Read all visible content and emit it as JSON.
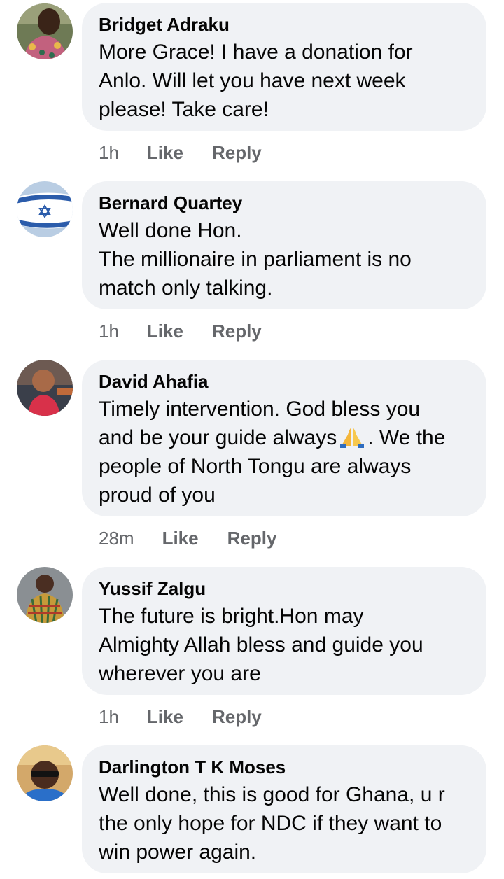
{
  "comments": [
    {
      "author": "Bridget Adraku",
      "lines": [
        "More Grace! I have a donation for",
        "Anlo. Will let you have next week",
        "please! Take care!"
      ],
      "time": "1h",
      "like_label": "Like",
      "reply_label": "Reply",
      "avatar_icon": "avatar-photo-woman"
    },
    {
      "author": "Bernard Quartey",
      "lines": [
        "Well done Hon.",
        "The millionaire in parliament is no",
        "match only talking."
      ],
      "time": "1h",
      "like_label": "Like",
      "reply_label": "Reply",
      "avatar_icon": "avatar-israel-flag"
    },
    {
      "author": "David Ahafia",
      "lines_before_emoji": "and be your guide always",
      "line1": "Timely intervention. God bless you",
      "line2_after_emoji": ". We the",
      "line3": "people of North Tongu are always",
      "line4": "proud of you",
      "emoji": "praying-hands-icon",
      "time": "28m",
      "like_label": "Like",
      "reply_label": "Reply",
      "avatar_icon": "avatar-photo-baby"
    },
    {
      "author": "Yussif Zalgu",
      "lines": [
        "The future is bright.Hon may",
        "Almighty Allah bless and guide you",
        "wherever you are"
      ],
      "time": "1h",
      "like_label": "Like",
      "reply_label": "Reply",
      "avatar_icon": "avatar-photo-man-kente"
    },
    {
      "author": "Darlington T K Moses",
      "lines": [
        "Well done, this is good for Ghana, u r",
        "the only hope for NDC if they want to",
        "win power again."
      ],
      "avatar_icon": "avatar-photo-man-sunglasses"
    }
  ],
  "colors": {
    "bubble_bg": "#f0f2f5",
    "text": "#050505",
    "meta": "#65676b"
  }
}
